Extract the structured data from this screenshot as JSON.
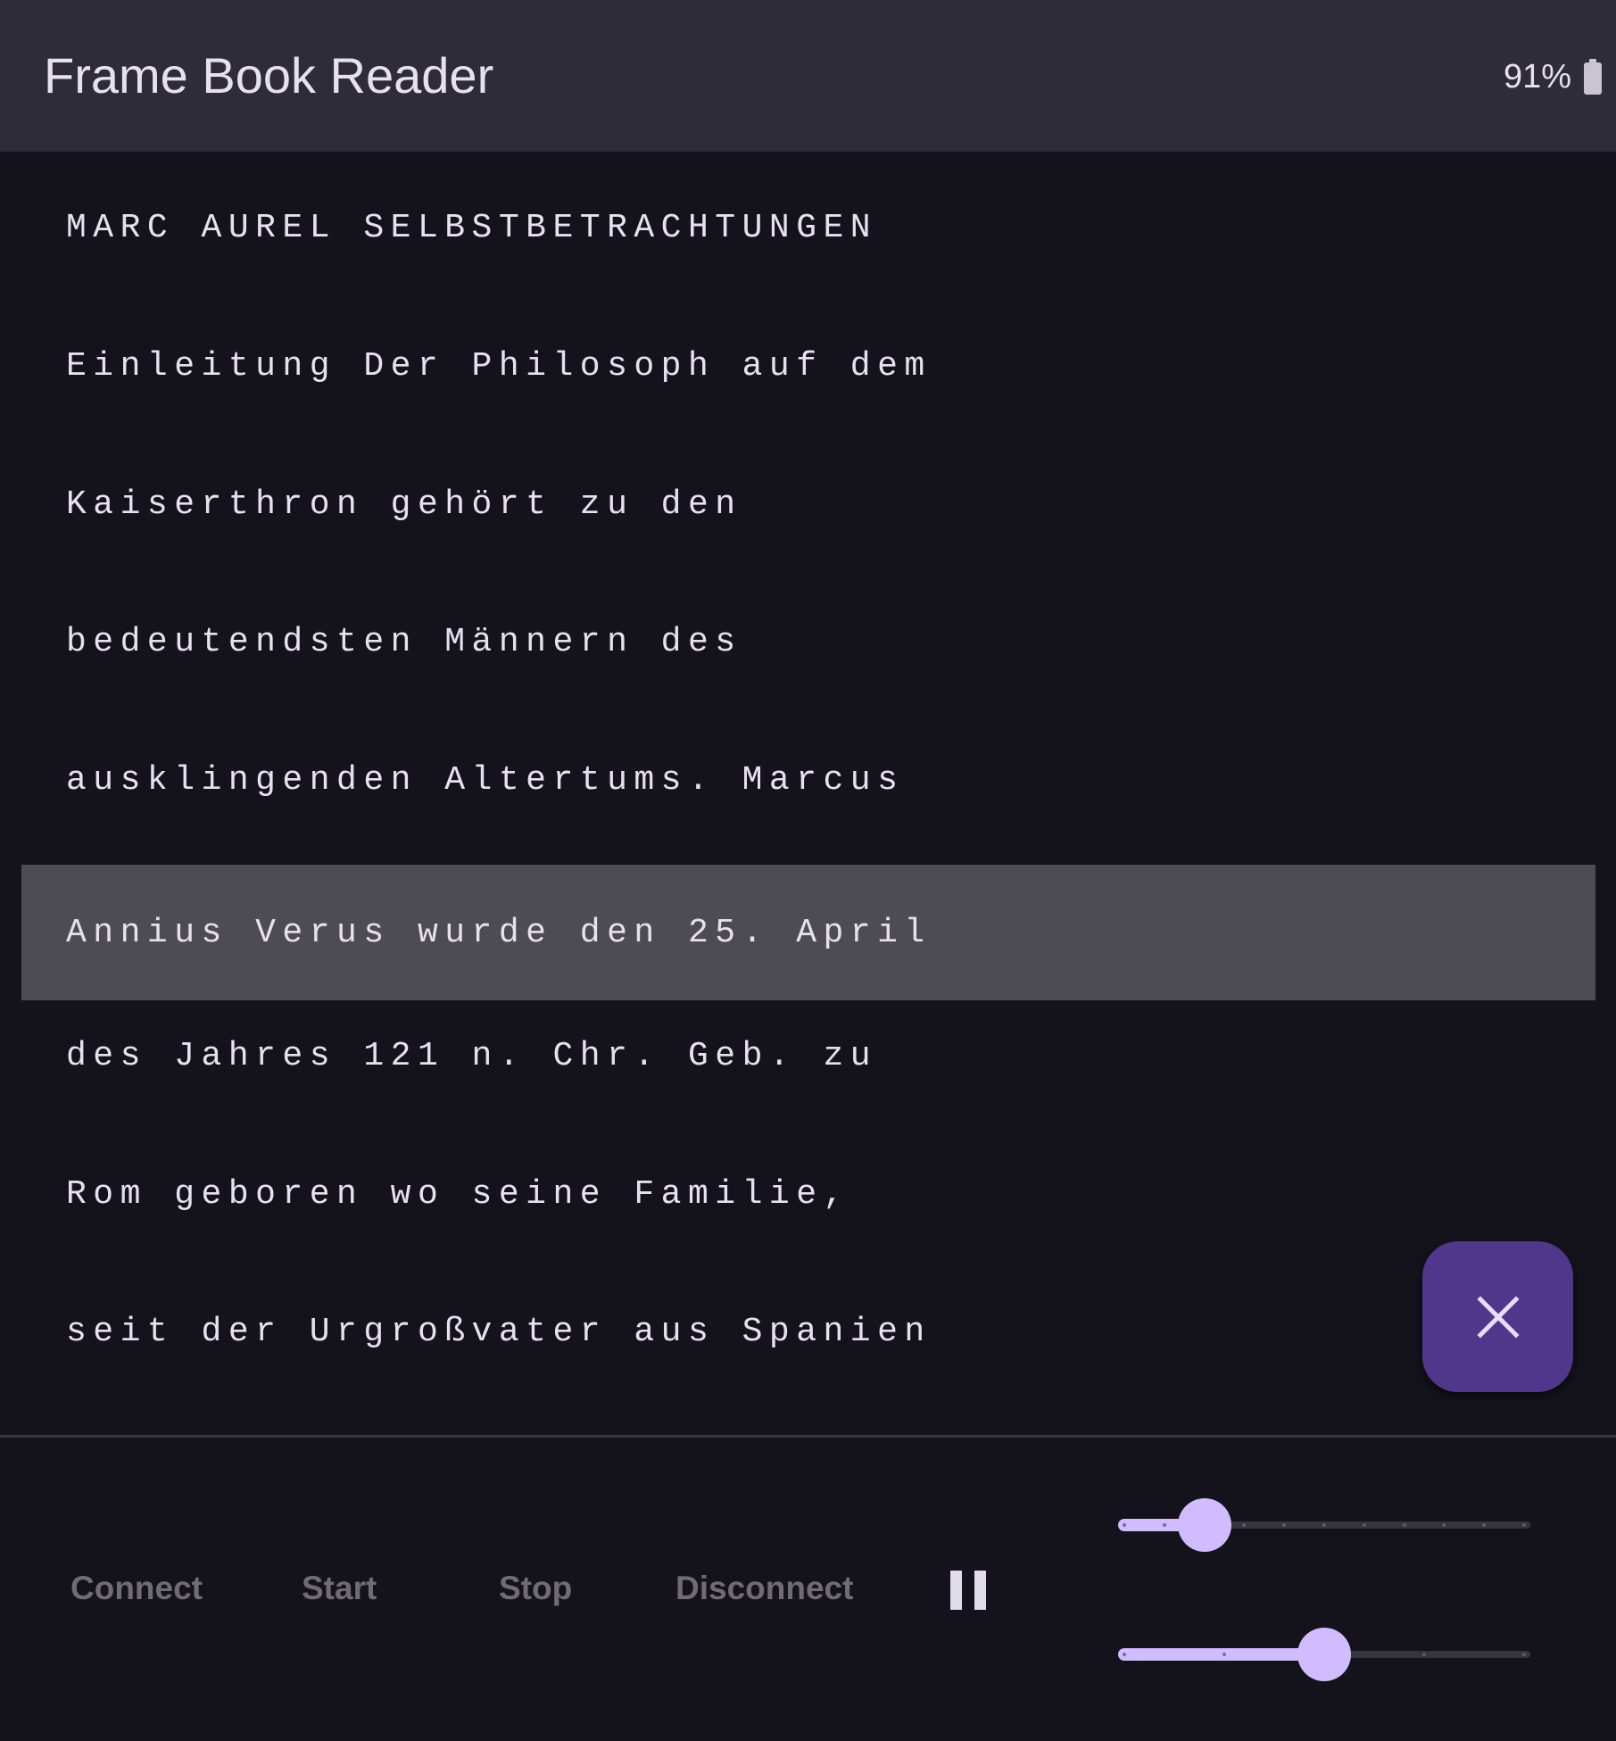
{
  "app": {
    "title": "Frame Book Reader"
  },
  "status": {
    "battery_text": "91%"
  },
  "reader": {
    "lines": [
      "MARC AUREL SELBSTBETRACHTUNGEN",
      "Einleitung Der Philosoph auf dem",
      "Kaiserthron gehört zu den",
      "bedeutendsten Männern des",
      "ausklingenden Altertums. Marcus",
      "Annius Verus wurde den 25. April",
      "des Jahres 121 n. Chr. Geb. zu",
      "Rom geboren wo seine Familie,",
      "seit der Urgroßvater aus Spanien"
    ],
    "highlighted_line_index": 5
  },
  "fab": {
    "icon": "close-icon"
  },
  "controls": {
    "connect_label": "Connect",
    "start_label": "Start",
    "stop_label": "Stop",
    "disconnect_label": "Disconnect",
    "pause_icon": "pause-icon"
  },
  "sliders": {
    "top": {
      "steps": 10,
      "value_step": 2
    },
    "bottom": {
      "steps": 4,
      "value_step": 2
    }
  },
  "colors": {
    "header_bg": "#2e2c38",
    "page_bg": "#14121a",
    "highlight_bg": "#4d4c53",
    "fab_bg": "#4f378b",
    "accent": "#d0bcff"
  }
}
